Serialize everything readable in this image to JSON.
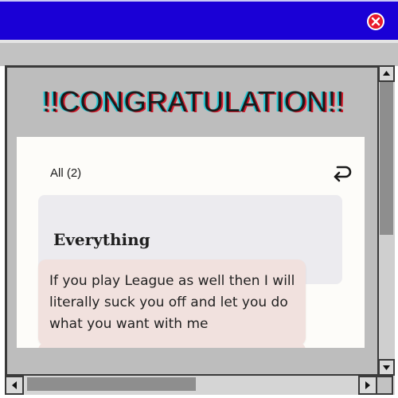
{
  "window": {
    "close_icon": "close-icon",
    "accent_color": "#1a00d6",
    "close_color": "#e8192c"
  },
  "main": {
    "title_prefix": "!!",
    "title_main": "CONGRATULATION",
    "title_suffix": "!!"
  },
  "panel": {
    "filter_label": "All (2)",
    "back_icon": "return-arrow-icon",
    "card_title": "Everything",
    "message": "If you play League as well then I will literally suck you off and let you do what you want with me"
  },
  "scrollbars": {
    "up_icon": "arrow-up-icon",
    "down_icon": "arrow-down-icon",
    "left_icon": "arrow-left-icon",
    "right_icon": "arrow-right-icon"
  }
}
